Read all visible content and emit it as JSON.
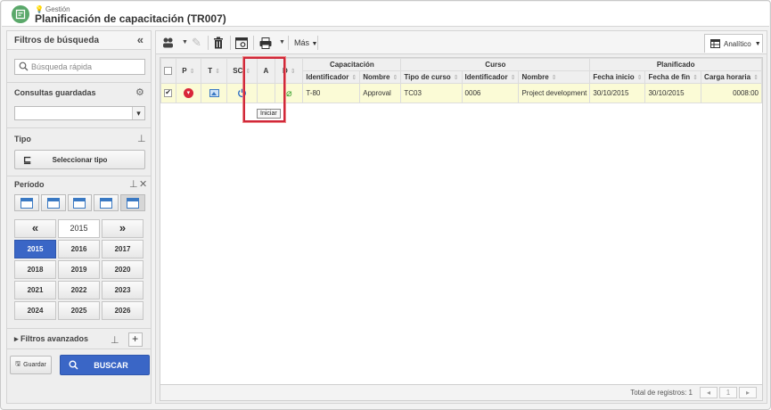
{
  "header": {
    "breadcrumb": "Gestión",
    "title": "Planificación de capacitación (TR007)",
    "icon": "training-app-icon"
  },
  "filters": {
    "title": "Filtros de búsqueda",
    "collapse_icon": "«",
    "search_placeholder": "Búsqueda rápida",
    "saved_queries_label": "Consultas guardadas",
    "saved_queries_value": "",
    "type_label": "Tipo",
    "select_type_label": "Seleccionar tipo",
    "period_label": "Período",
    "years_nav": {
      "prev": "«",
      "current": "2015",
      "next": "»"
    },
    "years": [
      [
        "2015",
        "2016",
        "2017"
      ],
      [
        "2018",
        "2019",
        "2020"
      ],
      [
        "2021",
        "2022",
        "2023"
      ],
      [
        "2024",
        "2025",
        "2026"
      ]
    ],
    "selected_year": "2015",
    "advanced_label": "Filtros avanzados",
    "save_label": "Guardar",
    "search_label": "BUSCAR"
  },
  "toolbar": {
    "more_label": "Más",
    "view_label": "Analítico"
  },
  "table": {
    "group_headers": [
      "Capacitación",
      "Curso",
      "Planificado"
    ],
    "columns": [
      "P",
      "T",
      "SC",
      "A",
      "D",
      "Identificador",
      "Nombre",
      "Tipo de curso",
      "Identificador",
      "Nombre",
      "Fecha inicio",
      "Fecha de fin",
      "Carga horaria"
    ],
    "rows": [
      {
        "selected": true,
        "training_id": "T-80",
        "training_name": "Approval",
        "course_type": "TC03",
        "course_id": "0006",
        "course_name": "Project development",
        "start_date": "30/10/2015",
        "end_date": "30/10/2015",
        "workload": "0008:00"
      }
    ],
    "tooltip": "Iniciar"
  },
  "footer": {
    "total_label": "Total de registros: 1",
    "page": "1"
  },
  "colors": {
    "accent": "#3a66c6",
    "row_highlight": "#fbfbd6",
    "highlight_box": "#d0283a",
    "app_icon": "#5aa86a"
  }
}
